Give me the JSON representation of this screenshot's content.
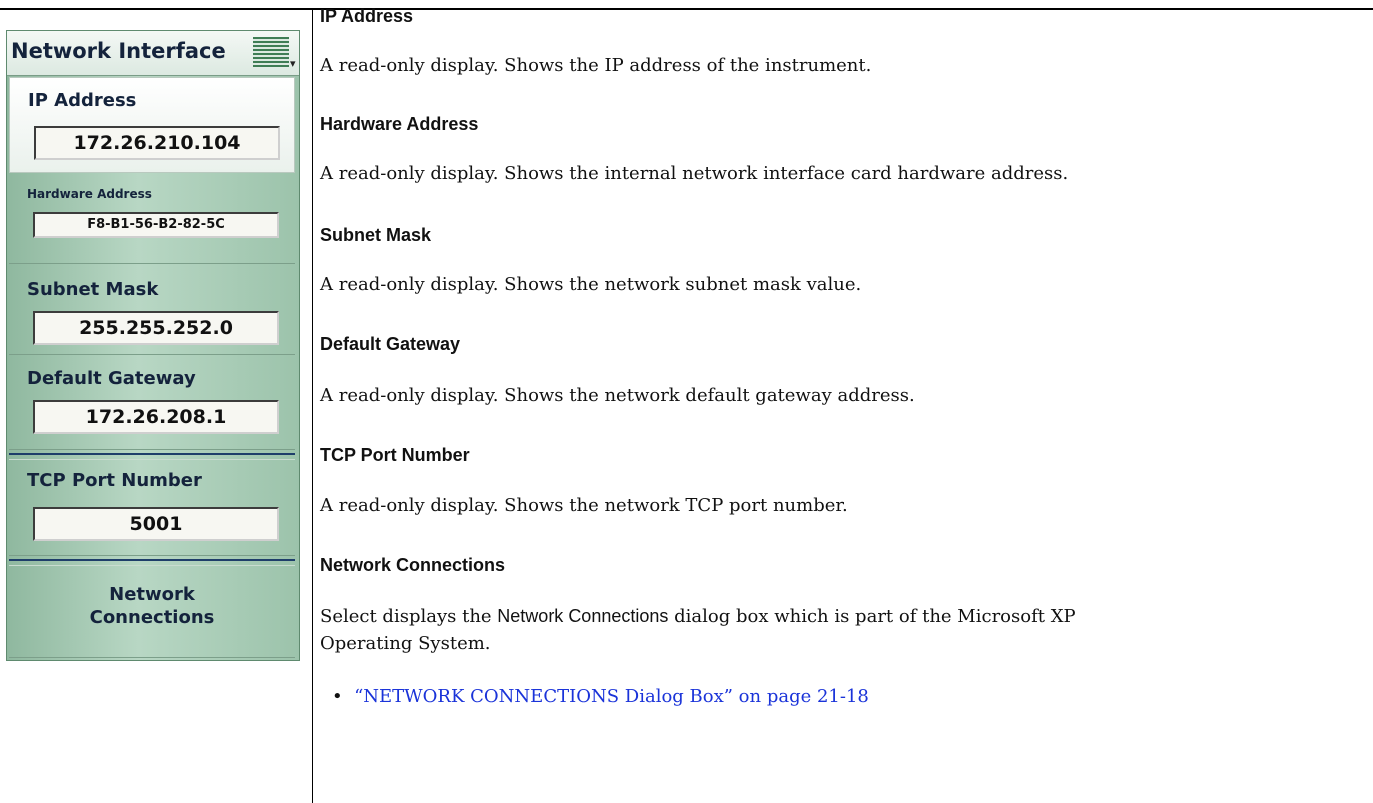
{
  "menu": {
    "title": "Network Interface",
    "ip_label": "IP Address",
    "ip_value": "172.26.210.104",
    "hw_label": "Hardware Address",
    "hw_value": "F8-B1-56-B2-82-5C",
    "subnet_label": "Subnet Mask",
    "subnet_value": "255.255.252.0",
    "gateway_label": "Default Gateway",
    "gateway_value": "172.26.208.1",
    "tcp_label": "TCP Port Number",
    "tcp_value": "5001",
    "netconn_line1": "Network",
    "netconn_line2": "Connections"
  },
  "sections": [
    {
      "heading": "IP Address",
      "text": "A read-only display. Shows the IP address of the instrument."
    },
    {
      "heading": "Hardware Address",
      "text": "A read-only display. Shows the internal network interface card hardware address."
    },
    {
      "heading": "Subnet Mask",
      "text": "A read-only display. Shows the network subnet mask value."
    },
    {
      "heading": "Default Gateway",
      "text": "A read-only display. Shows the network default gateway address."
    },
    {
      "heading": "TCP Port Number",
      "text": "A read-only display. Shows the network TCP port number."
    },
    {
      "heading": "Network Connections",
      "text_lead": "Select displays the ",
      "text_sans": "Network Connections",
      "text_tail": " dialog box which is part of the Microsoft XP",
      "text_line2": "Operating System."
    }
  ],
  "link": "“NETWORK CONNECTIONS Dialog Box” on page 21-18",
  "colors": {
    "link": "#1a33d9",
    "menu_green": "#9cc3ab",
    "menu_title_text": "#14233c"
  }
}
